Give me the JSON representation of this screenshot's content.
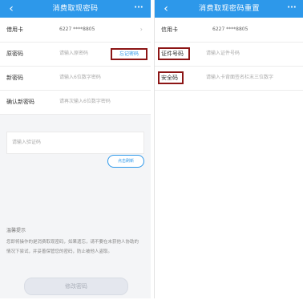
{
  "left_screen": {
    "title": "消费取现密码",
    "back_icon": "‹",
    "more_icon": "···",
    "rows": [
      {
        "label": "借用卡",
        "value": "6227 ****8805",
        "chevron": "›"
      },
      {
        "label": "原密码",
        "placeholder": "请输入原密码"
      },
      {
        "label": "新密码",
        "placeholder": "请输入6位数字密码"
      },
      {
        "label": "确认新密码",
        "placeholder": "请再次输入6位数字密码"
      }
    ],
    "forgot_button": "忘记密码",
    "captcha_placeholder": "请输入验证码",
    "refresh_button": "点击刷新",
    "tips_title": "温馨提示",
    "tips_text": "您即将操作的是消费取现密码，如果遗忘，请不要在未获他人协助的情况下尝试，并妥善保管您的密码，防止被他人盗取。",
    "submit_button": "修改密码"
  },
  "right_screen": {
    "title": "消费取现密码重置",
    "back_icon": "‹",
    "more_icon": "···",
    "rows": [
      {
        "label": "信用卡",
        "value": "6227 ****8805"
      },
      {
        "label": "证件号码",
        "placeholder": "请输入证件号码"
      },
      {
        "label": "安全码",
        "placeholder": "请输入卡背面签名栏末三位数字"
      }
    ]
  },
  "colors": {
    "header_blue": "#2d98ea",
    "highlight_red": "#8c1515"
  }
}
